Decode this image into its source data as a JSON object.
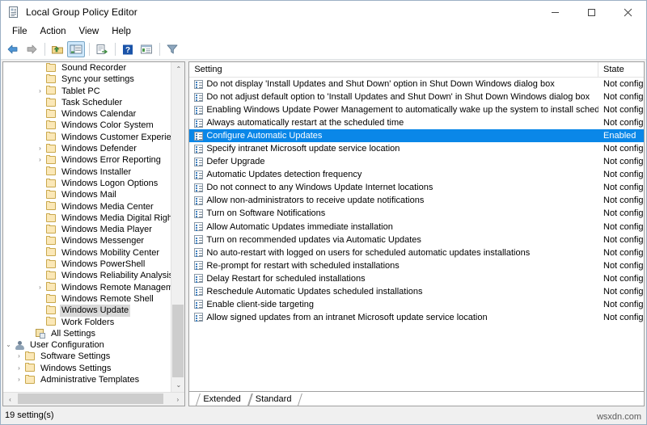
{
  "window": {
    "title": "Local Group Policy Editor",
    "icon": "policy-editor-icon",
    "minimize": "—",
    "maximize": "☐",
    "close": "✕"
  },
  "menubar": {
    "items": [
      {
        "label": "File"
      },
      {
        "label": "Action"
      },
      {
        "label": "View"
      },
      {
        "label": "Help"
      }
    ]
  },
  "toolbar": {
    "buttons": [
      {
        "name": "back-icon"
      },
      {
        "name": "forward-icon"
      },
      {
        "name": "separator"
      },
      {
        "name": "up-folder-icon"
      },
      {
        "name": "show-hide-tree-icon"
      },
      {
        "name": "separator"
      },
      {
        "name": "export-list-icon"
      },
      {
        "name": "separator"
      },
      {
        "name": "help-icon"
      },
      {
        "name": "properties-icon"
      },
      {
        "name": "separator"
      },
      {
        "name": "filter-icon"
      }
    ]
  },
  "tree": {
    "items": [
      {
        "label": "Sound Recorder",
        "indent": 4,
        "twisty": "",
        "icon": "folder",
        "selected": false
      },
      {
        "label": "Sync your settings",
        "indent": 4,
        "twisty": "",
        "icon": "folder",
        "selected": false
      },
      {
        "label": "Tablet PC",
        "indent": 4,
        "twisty": "›",
        "icon": "folder",
        "selected": false
      },
      {
        "label": "Task Scheduler",
        "indent": 4,
        "twisty": "",
        "icon": "folder",
        "selected": false
      },
      {
        "label": "Windows Calendar",
        "indent": 4,
        "twisty": "",
        "icon": "folder",
        "selected": false
      },
      {
        "label": "Windows Color System",
        "indent": 4,
        "twisty": "",
        "icon": "folder",
        "selected": false
      },
      {
        "label": "Windows Customer Experience Ir",
        "indent": 4,
        "twisty": "",
        "icon": "folder",
        "selected": false
      },
      {
        "label": "Windows Defender",
        "indent": 4,
        "twisty": "›",
        "icon": "folder",
        "selected": false
      },
      {
        "label": "Windows Error Reporting",
        "indent": 4,
        "twisty": "›",
        "icon": "folder",
        "selected": false
      },
      {
        "label": "Windows Installer",
        "indent": 4,
        "twisty": "",
        "icon": "folder",
        "selected": false
      },
      {
        "label": "Windows Logon Options",
        "indent": 4,
        "twisty": "",
        "icon": "folder",
        "selected": false
      },
      {
        "label": "Windows Mail",
        "indent": 4,
        "twisty": "",
        "icon": "folder",
        "selected": false
      },
      {
        "label": "Windows Media Center",
        "indent": 4,
        "twisty": "",
        "icon": "folder",
        "selected": false
      },
      {
        "label": "Windows Media Digital Rights M",
        "indent": 4,
        "twisty": "",
        "icon": "folder",
        "selected": false
      },
      {
        "label": "Windows Media Player",
        "indent": 4,
        "twisty": "",
        "icon": "folder",
        "selected": false
      },
      {
        "label": "Windows Messenger",
        "indent": 4,
        "twisty": "",
        "icon": "folder",
        "selected": false
      },
      {
        "label": "Windows Mobility Center",
        "indent": 4,
        "twisty": "",
        "icon": "folder",
        "selected": false
      },
      {
        "label": "Windows PowerShell",
        "indent": 4,
        "twisty": "",
        "icon": "folder",
        "selected": false
      },
      {
        "label": "Windows Reliability Analysis",
        "indent": 4,
        "twisty": "",
        "icon": "folder",
        "selected": false
      },
      {
        "label": "Windows Remote Management",
        "indent": 4,
        "twisty": "›",
        "icon": "folder",
        "selected": false
      },
      {
        "label": "Windows Remote Shell",
        "indent": 4,
        "twisty": "",
        "icon": "folder",
        "selected": false
      },
      {
        "label": "Windows Update",
        "indent": 4,
        "twisty": "",
        "icon": "folder",
        "selected": true
      },
      {
        "label": "Work Folders",
        "indent": 4,
        "twisty": "",
        "icon": "folder",
        "selected": false
      },
      {
        "label": "All Settings",
        "indent": 3,
        "twisty": "",
        "icon": "all-settings",
        "selected": false
      },
      {
        "label": "User Configuration",
        "indent": 1,
        "twisty": "⌄",
        "icon": "user-config",
        "selected": false
      },
      {
        "label": "Software Settings",
        "indent": 2,
        "twisty": "›",
        "icon": "folder",
        "selected": false
      },
      {
        "label": "Windows Settings",
        "indent": 2,
        "twisty": "›",
        "icon": "folder",
        "selected": false
      },
      {
        "label": "Administrative Templates",
        "indent": 2,
        "twisty": "›",
        "icon": "folder",
        "selected": false
      }
    ],
    "scroll_up_arrow": "⌃",
    "scroll_down_arrow": "⌄",
    "scroll_left_arrow": "‹",
    "scroll_right_arrow": "›"
  },
  "list": {
    "columns": [
      {
        "label": "Setting",
        "key": "name"
      },
      {
        "label": "State",
        "key": "state"
      }
    ],
    "rows": [
      {
        "name": "Do not display 'Install Updates and Shut Down' option in Shut Down Windows dialog box",
        "state": "Not configu",
        "selected": false
      },
      {
        "name": "Do not adjust default option to 'Install Updates and Shut Down' in Shut Down Windows dialog box",
        "state": "Not configu",
        "selected": false
      },
      {
        "name": "Enabling Windows Update Power Management to automatically wake up the system to install schedule...",
        "state": "Not configu",
        "selected": false
      },
      {
        "name": "Always automatically restart at the scheduled time",
        "state": "Not configu",
        "selected": false
      },
      {
        "name": "Configure Automatic Updates",
        "state": "Enabled",
        "selected": true
      },
      {
        "name": "Specify intranet Microsoft update service location",
        "state": "Not configu",
        "selected": false
      },
      {
        "name": "Defer Upgrade",
        "state": "Not configu",
        "selected": false
      },
      {
        "name": "Automatic Updates detection frequency",
        "state": "Not configu",
        "selected": false
      },
      {
        "name": "Do not connect to any Windows Update Internet locations",
        "state": "Not configu",
        "selected": false
      },
      {
        "name": "Allow non-administrators to receive update notifications",
        "state": "Not configu",
        "selected": false
      },
      {
        "name": "Turn on Software Notifications",
        "state": "Not configu",
        "selected": false
      },
      {
        "name": "Allow Automatic Updates immediate installation",
        "state": "Not configu",
        "selected": false
      },
      {
        "name": "Turn on recommended updates via Automatic Updates",
        "state": "Not configu",
        "selected": false
      },
      {
        "name": "No auto-restart with logged on users for scheduled automatic updates installations",
        "state": "Not configu",
        "selected": false
      },
      {
        "name": "Re-prompt for restart with scheduled installations",
        "state": "Not configu",
        "selected": false
      },
      {
        "name": "Delay Restart for scheduled installations",
        "state": "Not configu",
        "selected": false
      },
      {
        "name": "Reschedule Automatic Updates scheduled installations",
        "state": "Not configu",
        "selected": false
      },
      {
        "name": "Enable client-side targeting",
        "state": "Not configu",
        "selected": false
      },
      {
        "name": "Allow signed updates from an intranet Microsoft update service location",
        "state": "Not configu",
        "selected": false
      }
    ]
  },
  "tabs": [
    {
      "label": "Extended",
      "active": false
    },
    {
      "label": "Standard",
      "active": true
    }
  ],
  "statusbar": {
    "text": "19 setting(s)",
    "watermark": "wsxdn.com"
  },
  "colors": {
    "selection_blue": "#0a87e8",
    "tree_selection_gray": "#d9d9d9",
    "window_bg": "#f0f0f0"
  }
}
